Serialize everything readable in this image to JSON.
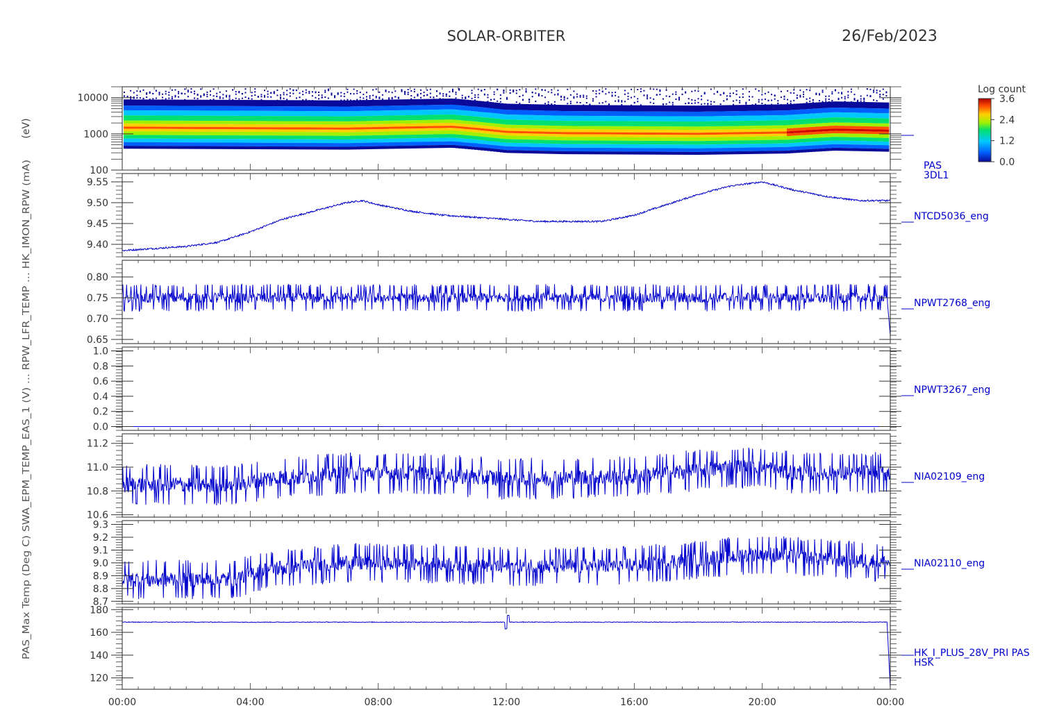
{
  "header": {
    "mission": "SOLAR-ORBITER",
    "date": "26/Feb/2023"
  },
  "left_labels": {
    "panel1": "(eV)",
    "overlap_text": "PAS_Max Temp (Deg C) SWA_EPM_TEMP_EAS_1 (V) ... RPW_LFR_TEMP ... HK_IMON_RPW (mA)"
  },
  "colorbar": {
    "title": "Log count",
    "ticks": [
      "3.6",
      "2.4",
      "1.2",
      "0.0"
    ]
  },
  "x_axis": {
    "ticks": [
      "00:00",
      "04:00",
      "08:00",
      "12:00",
      "16:00",
      "20:00",
      "00:00"
    ]
  },
  "chart_data": [
    {
      "type": "heatmap",
      "name": "PAS 3DL1",
      "label_lines": [
        "PAS",
        "3DL1"
      ],
      "yscale": "log",
      "ylim": [
        100,
        20000
      ],
      "yticks": [
        "10000",
        "1000",
        "100"
      ],
      "yticks_values": [
        10000,
        1000,
        100
      ],
      "x_hours": [
        0,
        24
      ],
      "peak_energy_ev_by_hour": [
        [
          0,
          1700
        ],
        [
          7,
          1600
        ],
        [
          10.3,
          1800
        ],
        [
          12,
          1300
        ],
        [
          13.8,
          1200
        ],
        [
          18,
          1150
        ],
        [
          20.8,
          1250
        ],
        [
          22.3,
          1500
        ],
        [
          24,
          1400
        ]
      ],
      "colorscale": {
        "min": 0.0,
        "max": 3.6,
        "units": "log count"
      }
    },
    {
      "type": "line",
      "name": "NTCD5036_eng",
      "label": "NTCD5036_eng",
      "ylim": [
        9.37,
        9.57
      ],
      "yticks": [
        "9.55",
        "9.50",
        "9.45",
        "9.40"
      ],
      "yticks_values": [
        9.55,
        9.5,
        9.45,
        9.4
      ],
      "x_hours": [
        0,
        1,
        2,
        3,
        4,
        5,
        6,
        7,
        7.5,
        8,
        9,
        10,
        11,
        12,
        13,
        14,
        15,
        16,
        17,
        18,
        19,
        20,
        21,
        22,
        23,
        24
      ],
      "values": [
        9.385,
        9.39,
        9.395,
        9.405,
        9.43,
        9.46,
        9.48,
        9.5,
        9.505,
        9.495,
        9.48,
        9.47,
        9.465,
        9.46,
        9.455,
        9.455,
        9.455,
        9.47,
        9.495,
        9.52,
        9.54,
        9.55,
        9.53,
        9.515,
        9.505,
        9.505
      ],
      "noise": 0.004,
      "color": "#0000cc"
    },
    {
      "type": "line",
      "name": "NPWT2768_eng",
      "label": "NPWT2768_eng",
      "ylim": [
        0.64,
        0.84
      ],
      "yticks": [
        "0.80",
        "0.75",
        "0.70",
        "0.65"
      ],
      "yticks_values": [
        0.8,
        0.75,
        0.7,
        0.65
      ],
      "baseline": 0.75,
      "noise": 0.03,
      "end_drop": 0.66,
      "color": "#0000cc"
    },
    {
      "type": "line",
      "name": "NPWT3267_eng",
      "label": "NPWT3267_eng",
      "ylim": [
        -0.05,
        1.05
      ],
      "yticks": [
        "1.0",
        "0.8",
        "0.6",
        "0.4",
        "0.2",
        "0.0"
      ],
      "yticks_values": [
        1.0,
        0.8,
        0.6,
        0.4,
        0.2,
        0.0
      ],
      "baseline": 0.0,
      "color": "#0000cc"
    },
    {
      "type": "line",
      "name": "NIA02109_eng",
      "label": "NIA02109_eng",
      "ylim": [
        10.58,
        11.28
      ],
      "yticks": [
        "11.2",
        "11.0",
        "10.8",
        "10.6"
      ],
      "yticks_values": [
        11.2,
        11.0,
        10.8,
        10.6
      ],
      "x_hours": [
        0,
        3.5,
        4.5,
        7,
        9,
        12,
        16,
        19,
        20,
        21,
        24
      ],
      "values": [
        10.85,
        10.85,
        10.9,
        10.95,
        10.95,
        10.9,
        10.92,
        11.0,
        11.0,
        10.95,
        10.95
      ],
      "noise": 0.16,
      "color": "#0000cc"
    },
    {
      "type": "line",
      "name": "NIA02110_eng",
      "label": "NIA02110_eng",
      "ylim": [
        8.68,
        9.33
      ],
      "yticks": [
        "9.3",
        "9.2",
        "9.1",
        "9.0",
        "8.9",
        "8.8",
        "8.7"
      ],
      "yticks_values": [
        9.3,
        9.2,
        9.1,
        9.0,
        8.9,
        8.8,
        8.7
      ],
      "x_hours": [
        0,
        3.5,
        4.5,
        7,
        9,
        12,
        16,
        19,
        20,
        21,
        24
      ],
      "values": [
        8.87,
        8.87,
        8.95,
        9.0,
        9.0,
        8.97,
        8.98,
        9.05,
        9.07,
        9.05,
        9.0
      ],
      "noise": 0.14,
      "color": "#0000cc"
    },
    {
      "type": "line",
      "name": "HK_I_PLUS_28V_PRI PAS HSK",
      "label_lines": [
        "HK_I_PLUS_28V_PRI PAS",
        "HSK"
      ],
      "ylim": [
        110,
        182
      ],
      "yticks": [
        "180",
        "160",
        "140",
        "120"
      ],
      "yticks_values": [
        180,
        160,
        140,
        120
      ],
      "baseline": 169,
      "noise": 0.6,
      "end_drop": 112,
      "color": "#0000cc"
    }
  ]
}
